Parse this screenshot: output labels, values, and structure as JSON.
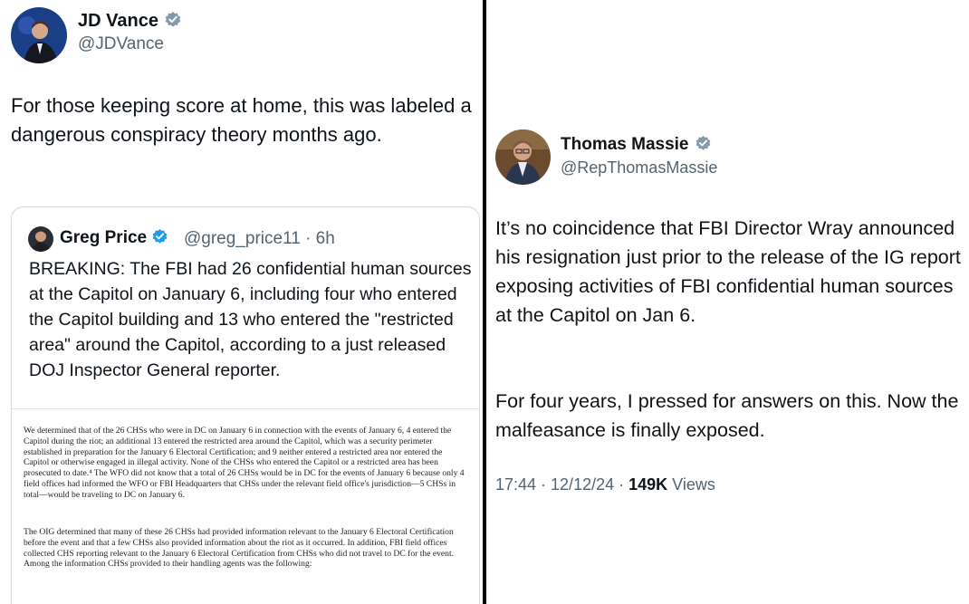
{
  "colors": {
    "verified_badge": "#829aab",
    "blue_badge": "#1d9bf0",
    "secondary_text": "#536471"
  },
  "left_tweet": {
    "author_name": "JD Vance",
    "author_handle": "@JDVance",
    "text": "For those keeping score at home, this was labeled a dangerous conspiracy theory months ago.",
    "quote": {
      "author_name": "Greg Price",
      "author_handle": "@greg_price11 · 6h",
      "text": "BREAKING: The FBI had 26 confidential human sources at the Capitol on January 6, including four who entered the Capitol building and 13 who entered the \"restricted area\" around the Capitol, according to a just released DOJ Inspector General reporter.",
      "document": {
        "paragraph1": "We determined that of the 26 CHSs who were in DC on January 6 in connection with the events of January 6, 4 entered the Capitol during the riot; an additional 13 entered the restricted area around the Capitol, which was a security perimeter established in preparation for the January 6 Electoral Certification; and 9 neither entered a restricted area nor entered the Capitol or otherwise engaged in illegal activity. None of the CHSs who entered the Capitol or a restricted area has been prosecuted to date.⁴ The WFO did not know that a total of 26 CHSs would be in DC for the events of January 6 because only 4 field offices had informed the WFO or FBI Headquarters that CHSs under the relevant field office's jurisdiction—5 CHSs in total—would be traveling to DC on January 6.",
        "paragraph2": "The OIG determined that many of these 26 CHSs had provided information relevant to the January 6 Electoral Certification before the event and that a few CHSs also provided information about the riot as it occurred. In addition, FBI field offices collected CHS reporting relevant to the January 6 Electoral Certification from CHSs who did not travel to DC for the event. Among the information CHSs provided to their handling agents was the following:"
      }
    }
  },
  "right_tweet": {
    "author_name": "Thomas Massie",
    "author_handle": "@RepThomasMassie",
    "text_paragraph1": "It’s no coincidence that FBI Director Wray announced his resignation just prior to the release of the IG report exposing activities of FBI confidential human sources at the Capitol on Jan 6.",
    "text_paragraph2": "For four years, I pressed for answers on this. Now the malfeasance is finally exposed.",
    "timestamp": "17:44 · 12/12/24 · ",
    "views_count": "149K",
    "views_label": " Views"
  }
}
